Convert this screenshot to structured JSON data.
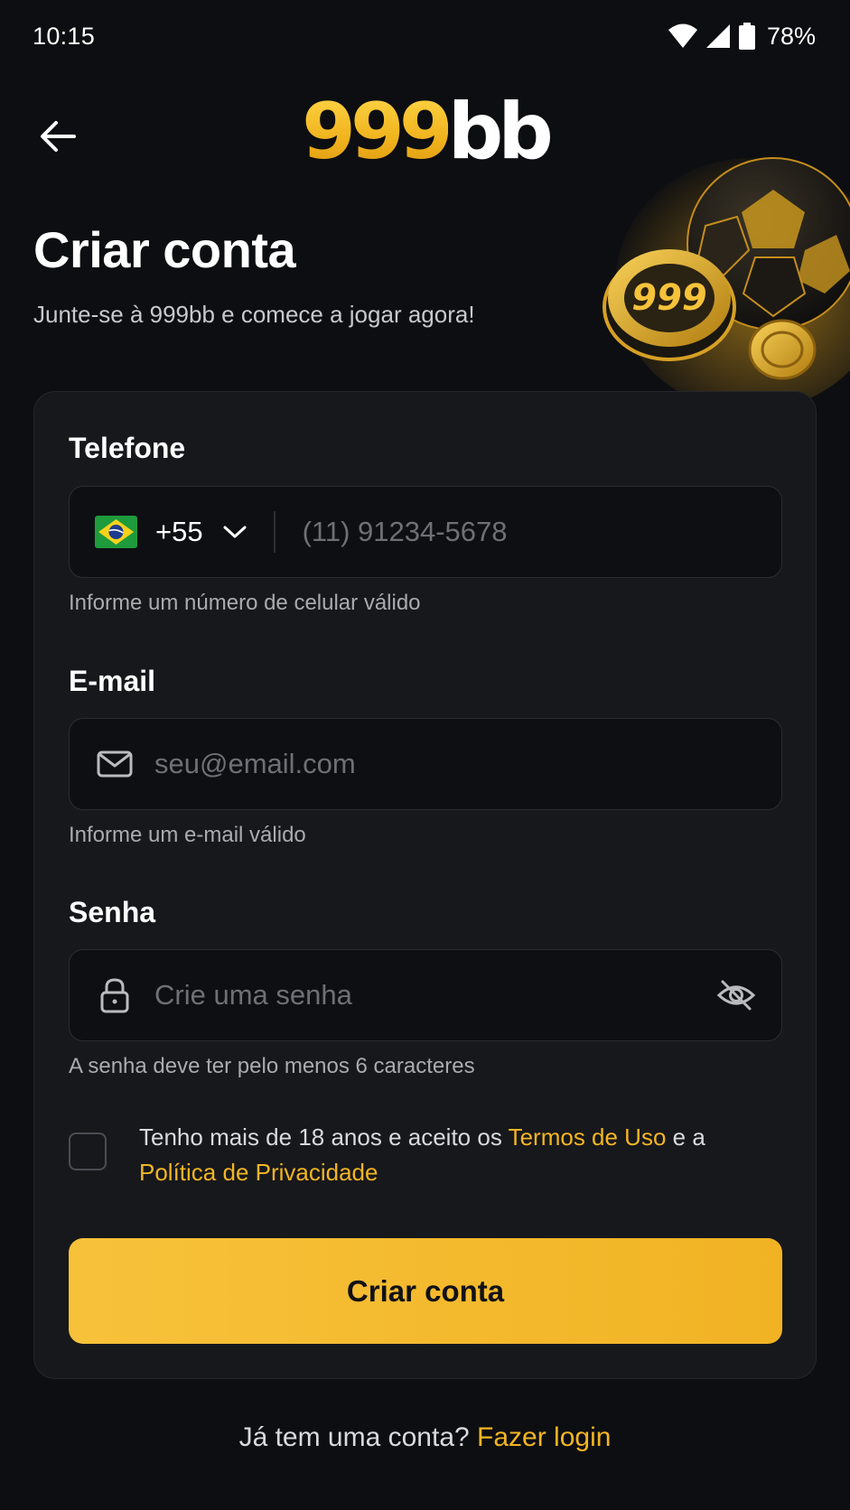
{
  "status_bar": {
    "time": "10:15",
    "battery": "78%",
    "icons": [
      "wifi-icon",
      "cell-signal-icon",
      "battery-icon"
    ]
  },
  "header": {
    "logo_number": "999",
    "logo_suffix": "bb",
    "back_icon": "arrow-left-icon"
  },
  "hero": {
    "chip_text": "999"
  },
  "page": {
    "title": "Criar conta",
    "subtitle": "Junte-se à 999bb e comece a jogar agora!"
  },
  "form": {
    "phone": {
      "label": "Telefone",
      "country_code": "+55",
      "flag": "brazil-flag-icon",
      "placeholder": "(11) 91234-5678",
      "helper": "Informe um número de celular válido"
    },
    "email": {
      "label": "E-mail",
      "icon": "mail-icon",
      "placeholder": "seu@email.com",
      "helper": "Informe um e-mail válido"
    },
    "password": {
      "label": "Senha",
      "icon": "lock-icon",
      "toggle_icon": "eye-off-icon",
      "placeholder": "Crie uma senha",
      "helper": "A senha deve ter pelo menos 6 caracteres"
    },
    "terms": {
      "checked": false,
      "text_before": "Tenho mais de 18 anos e aceito os ",
      "terms_link": "Termos de Uso",
      "text_middle": " e a ",
      "privacy_link": "Política de Privacidade"
    },
    "submit_label": "Criar conta"
  },
  "footer": {
    "prompt": "Já tem uma conta? ",
    "login_link": "Fazer login"
  },
  "colors": {
    "background": "#0d0e11",
    "card": "#17181c",
    "accent": "#f3b522",
    "button": "#f4bb2e"
  }
}
